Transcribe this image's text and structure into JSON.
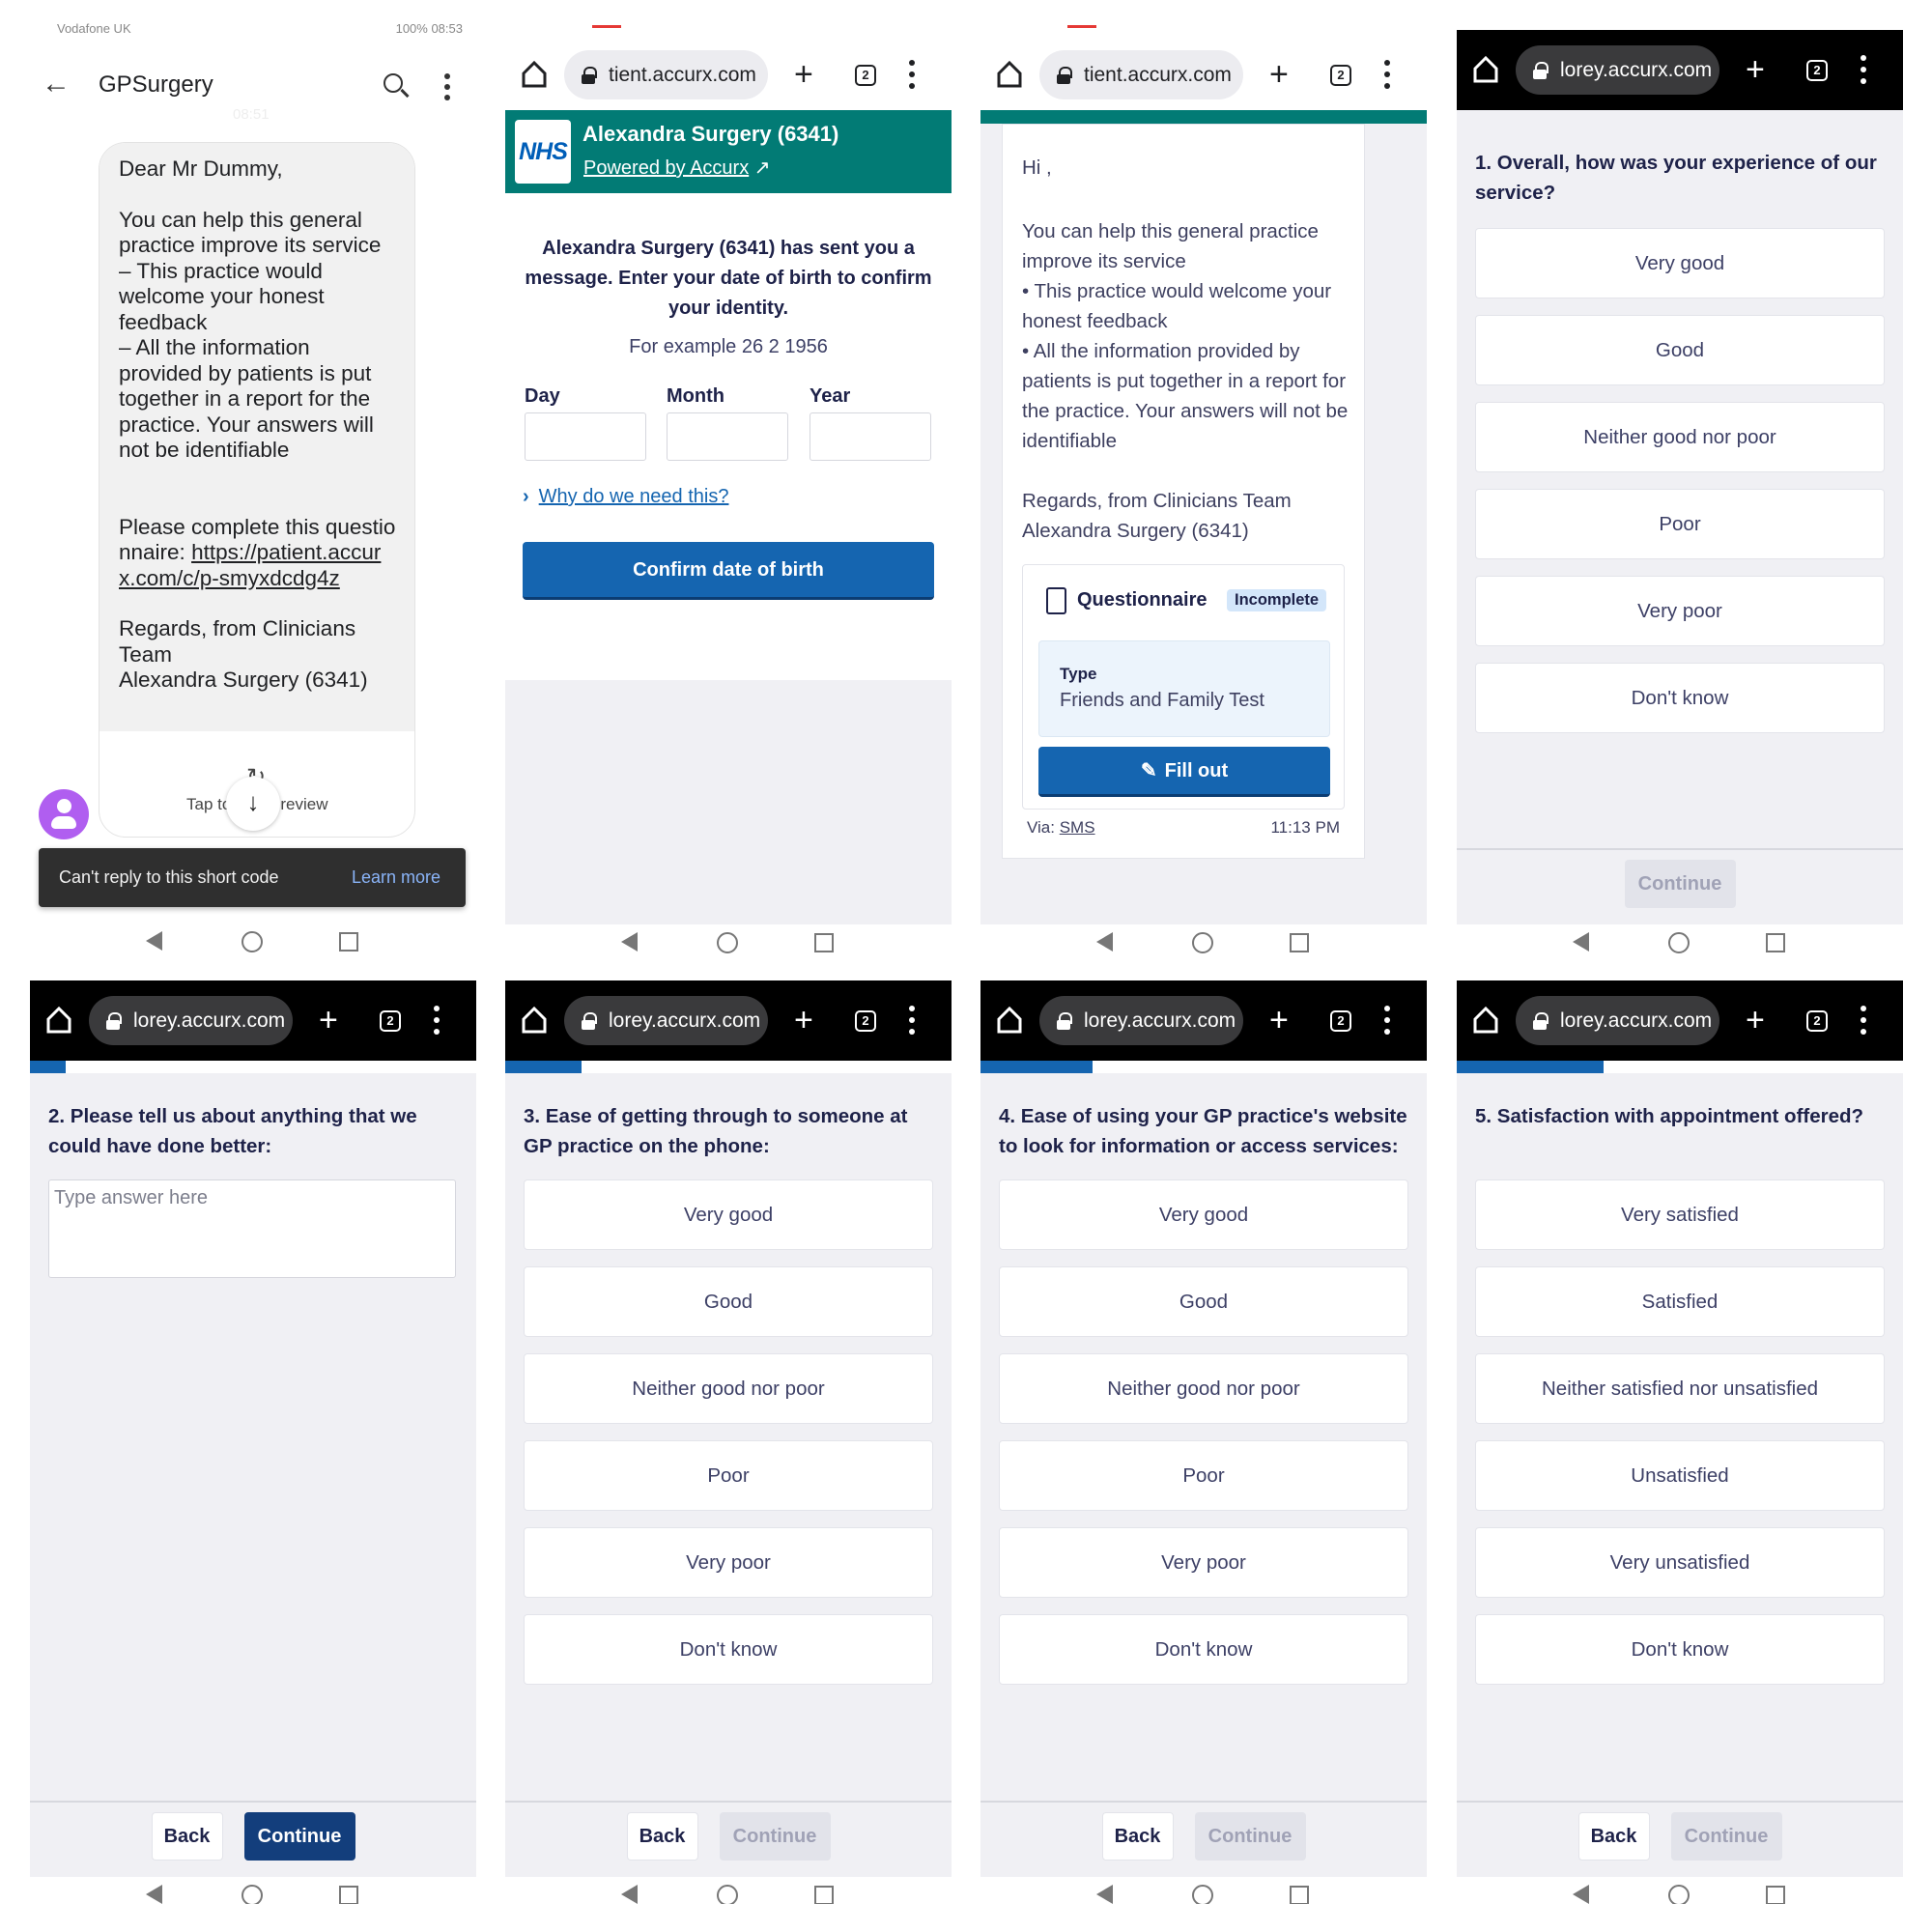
{
  "browser": {
    "tab_count": "2"
  },
  "sms": {
    "status_left": "Vodafone UK",
    "status_right": "100% 08:53",
    "title": "GPSurgery",
    "timestamp": "08:51",
    "greeting": "Dear Mr Dummy,",
    "body": "You can help this general practice improve its service\n– This practice would welcome your honest feedback\n– All the information provided by patients is put together in a report for the practice. Your answers will not be identifiable",
    "prompt": "Please complete this questionnaire: ",
    "link": "https://patient.accurx.com/c/p-smyxdcdg4z",
    "regards": "Regards, from Clinicians Team\nAlexandra Surgery (6341)",
    "preview": "Tap to load preview",
    "toast": "Can't reply to this short code",
    "learn_more": "Learn more"
  },
  "dob": {
    "url": "tient.accurx.com",
    "logo": "NHS",
    "practice": "Alexandra Surgery (6341)",
    "powered_by": "Powered by Accurx",
    "intro": "Alexandra Surgery (6341) has sent you a message. Enter your date of birth to confirm your identity.",
    "example": "For example 26 2 1956",
    "day_label": "Day",
    "month_label": "Month",
    "year_label": "Year",
    "day_value": "",
    "month_value": "",
    "year_value": "",
    "why_link": "Why do we need this?",
    "confirm": "Confirm date of birth",
    "colors": {
      "teal": "#027b75",
      "nhs_blue": "#005eb8",
      "button": "#1565b0"
    }
  },
  "message": {
    "url": "tient.accurx.com",
    "greeting": "Hi ,",
    "body": "You can help this general practice improve its service\n• This practice would welcome your honest feedback\n• All the information provided by patients is put together in a report for the practice. Your answers will not be identifiable",
    "regards": "Regards, from Clinicians Team\nAlexandra Surgery (6341)",
    "card_title": "Questionnaire",
    "status_badge": "Incomplete",
    "type_label": "Type",
    "type_value": "Friends and Family Test",
    "fill_out": "Fill out",
    "via_label": "Via: ",
    "via_value": "SMS",
    "time": "11:13 PM"
  },
  "questions": [
    {
      "url": "lorey.accurx.com",
      "progress_pct": 0,
      "title": "1. Overall, how was your experience of our service?",
      "options": [
        "Very good",
        "Good",
        "Neither good nor poor",
        "Poor",
        "Very poor",
        "Don't know"
      ],
      "back": "",
      "continue": "Continue",
      "continue_enabled": false
    },
    {
      "url": "lorey.accurx.com",
      "progress_pct": 8,
      "title": "2. Please tell us about anything that we could have done better:",
      "placeholder": "Type answer here",
      "back": "Back",
      "continue": "Continue",
      "continue_enabled": true
    },
    {
      "url": "lorey.accurx.com",
      "progress_pct": 17,
      "title": "3. Ease of getting through to someone at GP practice on the phone:",
      "options": [
        "Very good",
        "Good",
        "Neither good nor poor",
        "Poor",
        "Very poor",
        "Don't know"
      ],
      "back": "Back",
      "continue": "Continue",
      "continue_enabled": false
    },
    {
      "url": "lorey.accurx.com",
      "progress_pct": 25,
      "title": "4. Ease of using your GP practice's website to look for information or access services:",
      "options": [
        "Very good",
        "Good",
        "Neither good nor poor",
        "Poor",
        "Very poor",
        "Don't know"
      ],
      "back": "Back",
      "continue": "Continue",
      "continue_enabled": false
    },
    {
      "url": "lorey.accurx.com",
      "progress_pct": 33,
      "title": "5. Satisfaction with appointment offered?",
      "options": [
        "Very satisfied",
        "Satisfied",
        "Neither satisfied nor unsatisfied",
        "Unsatisfied",
        "Very unsatisfied",
        "Don't know"
      ],
      "back": "Back",
      "continue": "Continue",
      "continue_enabled": false
    }
  ]
}
